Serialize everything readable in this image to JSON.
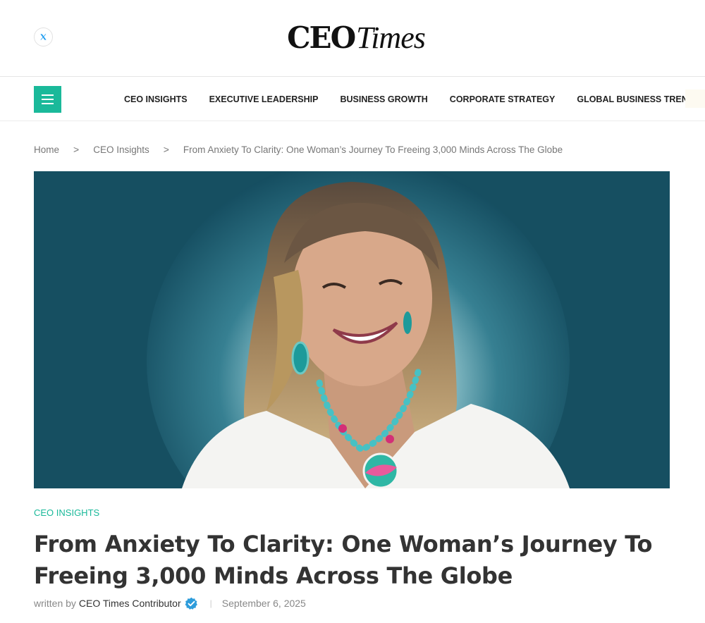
{
  "header": {
    "social": {
      "icon": "x-twitter-icon"
    },
    "logo": {
      "part1": "CEO",
      "part2": "Times"
    }
  },
  "nav": {
    "menu_icon": "hamburger-menu-icon",
    "accent_color": "#1ab99a",
    "links": [
      {
        "label": "CEO INSIGHTS"
      },
      {
        "label": "EXECUTIVE LEADERSHIP"
      },
      {
        "label": "BUSINESS GROWTH"
      },
      {
        "label": "CORPORATE STRATEGY"
      },
      {
        "label": "GLOBAL BUSINESS TRENDS"
      }
    ]
  },
  "breadcrumb": {
    "home": "Home",
    "separator": ">",
    "category": "CEO Insights",
    "current": "From Anxiety To Clarity: One Woman’s Journey To Freeing 3,000 Minds Across The Globe"
  },
  "article": {
    "category": "CEO INSIGHTS",
    "title_line1": "From Anxiety To Clarity: One Woman’s Journey To",
    "title_line2": "Freeing 3,000 Minds Across The Globe",
    "written_by": "written by",
    "author": "CEO Times Contributor",
    "verified_icon": "verified-badge-icon",
    "separator": "|",
    "date": "September 6, 2025"
  }
}
